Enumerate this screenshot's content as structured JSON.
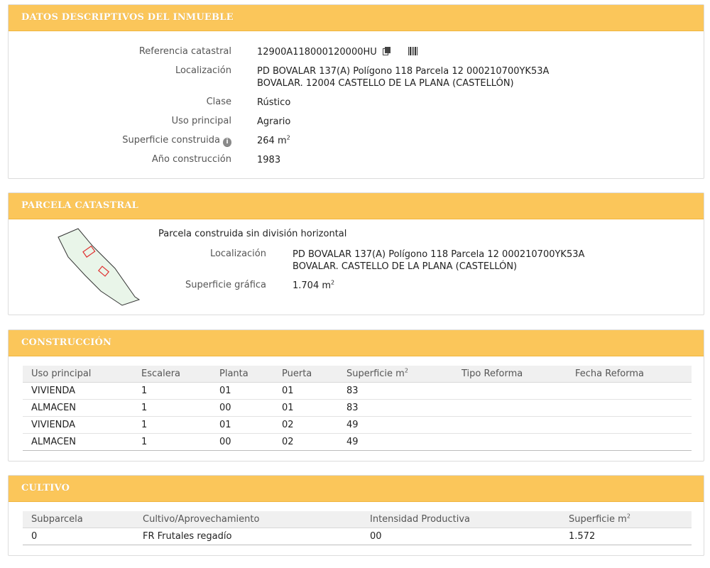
{
  "datos": {
    "title": "DATOS DESCRIPTIVOS DEL INMUEBLE",
    "referencia_label": "Referencia catastral",
    "referencia_value": "12900A118000120000HU",
    "localizacion_label": "Localización",
    "localizacion_line1": "PD BOVALAR 137(A) Polígono 118 Parcela 12 000210700YK53A",
    "localizacion_line2": "BOVALAR. 12004 CASTELLO DE LA PLANA (CASTELLÓN)",
    "clase_label": "Clase",
    "clase_value": "Rústico",
    "uso_label": "Uso principal",
    "uso_value": "Agrario",
    "superficie_label": "Superficie construida",
    "superficie_value": "264 m",
    "anio_label": "Año construcción",
    "anio_value": "1983"
  },
  "parcela": {
    "title": "PARCELA CATASTRAL",
    "descripcion": "Parcela construida sin división horizontal",
    "localizacion_label": "Localización",
    "localizacion_line1": "PD BOVALAR 137(A) Polígono 118 Parcela 12 000210700YK53A",
    "localizacion_line2": "BOVALAR. CASTELLO DE LA PLANA (CASTELLÓN)",
    "superficie_label": "Superficie gráfica",
    "superficie_value": "1.704 m"
  },
  "construccion": {
    "title": "CONSTRUCCIÓN",
    "headers": [
      "Uso principal",
      "Escalera",
      "Planta",
      "Puerta",
      "Superficie m",
      "Tipo Reforma",
      "Fecha Reforma"
    ],
    "rows": [
      [
        "VIVIENDA",
        "1",
        "01",
        "01",
        "83",
        "",
        ""
      ],
      [
        "ALMACEN",
        "1",
        "00",
        "01",
        "83",
        "",
        ""
      ],
      [
        "VIVIENDA",
        "1",
        "01",
        "02",
        "49",
        "",
        ""
      ],
      [
        "ALMACEN",
        "1",
        "00",
        "02",
        "49",
        "",
        ""
      ]
    ]
  },
  "cultivo": {
    "title": "CULTIVO",
    "headers": [
      "Subparcela",
      "Cultivo/Aprovechamiento",
      "Intensidad Productiva",
      "Superficie m"
    ],
    "rows": [
      [
        "0",
        "FR Frutales regadío",
        "00",
        "1.572"
      ]
    ]
  },
  "units": {
    "sq": "2"
  },
  "icons": {
    "copy": "copy-icon",
    "barcode": "barcode-icon",
    "info": "info-icon"
  },
  "colors": {
    "header_bg": "#fbc65a",
    "header_text": "#ffffff",
    "parcel_outline": "#333333",
    "building_outline": "#e03030"
  }
}
